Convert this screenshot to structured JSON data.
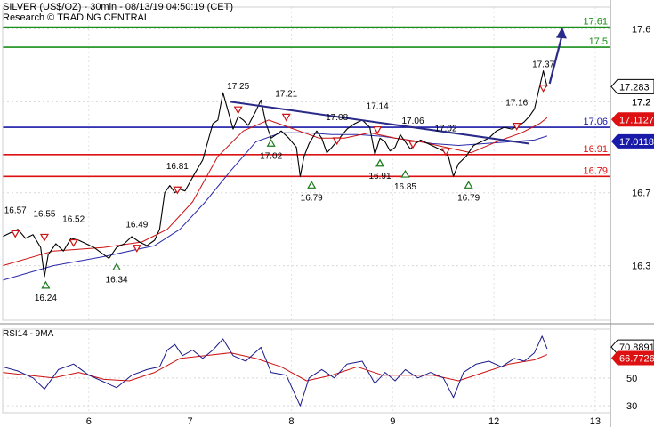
{
  "header": {
    "title": "SILVER (US$/OZ) - 30min - 08/13/19 04:50:19 (CET)",
    "subtitle": "Research © TRADING CENTRAL"
  },
  "colors": {
    "resistance": "#1a8f1a",
    "pivot": "#1a1aa8",
    "support": "#dd1111",
    "trendline": "#2a2a88",
    "arrow": "#2a2a88",
    "price": "#000000",
    "ma_fast": "#cc1111",
    "ma_slow": "#2a2aaa",
    "rsi": "#1a1a88",
    "rsi_ma": "#cc1111",
    "peak_marker": "#cc1111",
    "trough_marker": "#1a7a1a"
  },
  "chart_data": [
    {
      "type": "line",
      "name": "price-panel",
      "ylim": [
        16.0,
        17.72
      ],
      "y_ticks": [
        "17.6",
        "17.2",
        "16.7",
        "16.3"
      ],
      "x_labels": [
        "6",
        "7",
        "8",
        "9",
        "12",
        "13"
      ],
      "grid": true,
      "levels": [
        {
          "value": 17.61,
          "label": "17.61",
          "kind": "resistance"
        },
        {
          "value": 17.5,
          "label": "17.5",
          "kind": "resistance"
        },
        {
          "value": 17.06,
          "label": "17.06",
          "kind": "pivot"
        },
        {
          "value": 16.91,
          "label": "16.91",
          "kind": "support"
        },
        {
          "value": 16.79,
          "label": "16.79",
          "kind": "support"
        }
      ],
      "price_tags": [
        {
          "value": 17.283,
          "label": "17.283",
          "style": "dark"
        },
        {
          "value": 17.1127,
          "label": "17.1127",
          "style": "red"
        },
        {
          "value": 17.0118,
          "label": "17.0118",
          "style": "blue"
        }
      ],
      "partial_tick": "17.2",
      "price_points": [
        [
          0,
          16.46
        ],
        [
          0.3,
          16.48
        ],
        [
          0.6,
          16.5
        ],
        [
          0.9,
          16.45
        ],
        [
          1.2,
          16.47
        ],
        [
          1.5,
          16.4
        ],
        [
          1.65,
          16.24
        ],
        [
          1.8,
          16.36
        ],
        [
          2.1,
          16.42
        ],
        [
          2.4,
          16.38
        ],
        [
          2.7,
          16.45
        ],
        [
          3,
          16.44
        ],
        [
          3.3,
          16.42
        ],
        [
          3.6,
          16.4
        ],
        [
          3.9,
          16.37
        ],
        [
          4.2,
          16.34
        ],
        [
          4.5,
          16.4
        ],
        [
          4.8,
          16.42
        ],
        [
          5.1,
          16.46
        ],
        [
          5.4,
          16.43
        ],
        [
          5.7,
          16.41
        ],
        [
          6,
          16.44
        ],
        [
          6.2,
          16.5
        ],
        [
          6.4,
          16.7
        ],
        [
          6.6,
          16.74
        ],
        [
          6.8,
          16.7
        ],
        [
          7,
          16.72
        ],
        [
          7.2,
          16.71
        ],
        [
          7.4,
          16.76
        ],
        [
          7.6,
          16.81
        ],
        [
          7.9,
          16.88
        ],
        [
          8.1,
          16.98
        ],
        [
          8.3,
          17.08
        ],
        [
          8.5,
          17.1
        ],
        [
          8.7,
          17.25
        ],
        [
          8.9,
          17.15
        ],
        [
          9.1,
          17.05
        ],
        [
          9.3,
          17.12
        ],
        [
          9.5,
          17.1
        ],
        [
          9.7,
          17.07
        ],
        [
          10,
          17.15
        ],
        [
          10.2,
          17.21
        ],
        [
          10.4,
          17.08
        ],
        [
          10.6,
          17.0
        ],
        [
          10.8,
          17.02
        ],
        [
          11,
          17.04
        ],
        [
          11.3,
          17.0
        ],
        [
          11.6,
          16.95
        ],
        [
          11.75,
          16.79
        ],
        [
          11.9,
          16.9
        ],
        [
          12.1,
          16.97
        ],
        [
          12.4,
          17.04
        ],
        [
          12.6,
          17.0
        ],
        [
          12.8,
          16.92
        ],
        [
          13,
          16.95
        ],
        [
          13.3,
          17.0
        ],
        [
          13.6,
          17.05
        ],
        [
          13.9,
          17.08
        ],
        [
          14.2,
          17.1
        ],
        [
          14.5,
          17.06
        ],
        [
          14.7,
          16.91
        ],
        [
          14.9,
          17.0
        ],
        [
          15.1,
          16.98
        ],
        [
          15.3,
          16.93
        ],
        [
          15.5,
          16.95
        ],
        [
          15.7,
          17.02
        ],
        [
          15.9,
          16.98
        ],
        [
          16.1,
          16.94
        ],
        [
          16.3,
          16.97
        ],
        [
          16.5,
          16.99
        ],
        [
          16.8,
          16.97
        ],
        [
          17.1,
          16.95
        ],
        [
          17.4,
          16.93
        ],
        [
          17.6,
          16.9
        ],
        [
          17.8,
          16.79
        ],
        [
          18,
          16.86
        ],
        [
          18.3,
          16.9
        ],
        [
          18.6,
          16.96
        ],
        [
          18.9,
          16.98
        ],
        [
          19.2,
          17.0
        ],
        [
          19.5,
          17.04
        ],
        [
          19.8,
          17.06
        ],
        [
          20.1,
          17.05
        ],
        [
          20.4,
          17.07
        ],
        [
          20.6,
          17.09
        ],
        [
          20.8,
          17.12
        ],
        [
          21,
          17.16
        ],
        [
          21.2,
          17.28
        ],
        [
          21.35,
          17.37
        ],
        [
          21.5,
          17.283
        ]
      ],
      "ma_fast": [
        [
          0,
          16.3
        ],
        [
          2,
          16.38
        ],
        [
          4,
          16.4
        ],
        [
          5.5,
          16.43
        ],
        [
          6.5,
          16.5
        ],
        [
          7.5,
          16.65
        ],
        [
          8.5,
          16.9
        ],
        [
          9.5,
          17.04
        ],
        [
          10.5,
          17.1
        ],
        [
          11.5,
          17.05
        ],
        [
          12.5,
          17.0
        ],
        [
          13.5,
          17.0
        ],
        [
          14.5,
          17.03
        ],
        [
          15.5,
          17.0
        ],
        [
          16.5,
          16.98
        ],
        [
          17.5,
          16.95
        ],
        [
          18.5,
          16.92
        ],
        [
          19.5,
          16.98
        ],
        [
          20.5,
          17.03
        ],
        [
          21.2,
          17.08
        ],
        [
          21.5,
          17.1127
        ]
      ],
      "ma_slow": [
        [
          0,
          16.22
        ],
        [
          2,
          16.3
        ],
        [
          4,
          16.35
        ],
        [
          6,
          16.41
        ],
        [
          7,
          16.5
        ],
        [
          8,
          16.65
        ],
        [
          9,
          16.82
        ],
        [
          10,
          16.98
        ],
        [
          11,
          17.03
        ],
        [
          12,
          17.03
        ],
        [
          13,
          17.02
        ],
        [
          14,
          17.02
        ],
        [
          15,
          17.01
        ],
        [
          16,
          16.99
        ],
        [
          17,
          16.97
        ],
        [
          18,
          16.96
        ],
        [
          19,
          16.97
        ],
        [
          20,
          16.98
        ],
        [
          21,
          16.99
        ],
        [
          21.5,
          17.0118
        ]
      ],
      "trendline": [
        [
          9.0,
          17.2
        ],
        [
          20.8,
          16.97
        ]
      ],
      "forecast_arrow": [
        [
          21.6,
          17.3
        ],
        [
          22.1,
          17.61
        ]
      ],
      "peaks": [
        {
          "x": 0.5,
          "value": 16.57,
          "label": "16.57"
        },
        {
          "x": 1.65,
          "value": 16.55,
          "label": "16.55"
        },
        {
          "x": 2.8,
          "value": 16.52,
          "label": "16.52"
        },
        {
          "x": 5.3,
          "value": 16.49,
          "label": "16.49"
        },
        {
          "x": 6.9,
          "value": 16.81,
          "label": "16.81"
        },
        {
          "x": 9.3,
          "value": 17.25,
          "label": "17.25"
        },
        {
          "x": 11.2,
          "value": 17.21,
          "label": "17.21"
        },
        {
          "x": 13.2,
          "value": 17.08,
          "label": "17.08"
        },
        {
          "x": 14.8,
          "value": 17.14,
          "label": "17.14"
        },
        {
          "x": 16.2,
          "value": 17.06,
          "label": "17.06"
        },
        {
          "x": 17.5,
          "value": 17.02,
          "label": "17.02"
        },
        {
          "x": 20.3,
          "value": 17.16,
          "label": "17.16"
        },
        {
          "x": 21.35,
          "value": 17.37,
          "label": "17.37"
        }
      ],
      "troughs": [
        {
          "x": 1.7,
          "value": 16.24,
          "label": "16.24"
        },
        {
          "x": 4.5,
          "value": 16.34,
          "label": "16.34"
        },
        {
          "x": 10.6,
          "value": 17.02,
          "label": "17.02"
        },
        {
          "x": 12.2,
          "value": 16.79,
          "label": "16.79"
        },
        {
          "x": 14.9,
          "value": 16.91,
          "label": "16.91"
        },
        {
          "x": 15.9,
          "value": 16.85,
          "label": "16.85"
        },
        {
          "x": 18.4,
          "value": 16.79,
          "label": "16.79"
        }
      ]
    },
    {
      "type": "line",
      "name": "rsi-panel",
      "title": "RSI14 - 9MA",
      "ylim": [
        25,
        85
      ],
      "y_ticks": [
        "70",
        "50",
        "30"
      ],
      "value_tags": [
        {
          "value": 70.8891,
          "label": "70.8891",
          "style": "dark"
        },
        {
          "value": 66.7726,
          "label": "66.7726",
          "style": "red"
        }
      ],
      "rsi": [
        [
          0,
          58
        ],
        [
          0.6,
          55
        ],
        [
          1.2,
          50
        ],
        [
          1.65,
          42
        ],
        [
          2.2,
          56
        ],
        [
          2.8,
          60
        ],
        [
          3.4,
          52
        ],
        [
          3.9,
          48
        ],
        [
          4.5,
          43
        ],
        [
          5.1,
          52
        ],
        [
          5.7,
          56
        ],
        [
          6.2,
          58
        ],
        [
          6.5,
          70
        ],
        [
          6.8,
          74
        ],
        [
          7.1,
          66
        ],
        [
          7.5,
          70
        ],
        [
          7.9,
          64
        ],
        [
          8.3,
          70
        ],
        [
          8.7,
          78
        ],
        [
          9.1,
          66
        ],
        [
          9.6,
          62
        ],
        [
          10.2,
          72
        ],
        [
          10.6,
          54
        ],
        [
          11.2,
          52
        ],
        [
          11.75,
          30
        ],
        [
          12.1,
          50
        ],
        [
          12.6,
          56
        ],
        [
          13.1,
          50
        ],
        [
          13.6,
          60
        ],
        [
          14.2,
          62
        ],
        [
          14.7,
          46
        ],
        [
          15.1,
          54
        ],
        [
          15.5,
          48
        ],
        [
          15.9,
          56
        ],
        [
          16.4,
          50
        ],
        [
          16.9,
          54
        ],
        [
          17.4,
          50
        ],
        [
          17.8,
          36
        ],
        [
          18.2,
          54
        ],
        [
          18.7,
          60
        ],
        [
          19.2,
          62
        ],
        [
          19.7,
          58
        ],
        [
          20.2,
          64
        ],
        [
          20.6,
          62
        ],
        [
          21,
          68
        ],
        [
          21.3,
          80
        ],
        [
          21.5,
          70.89
        ]
      ],
      "rsi_ma": [
        [
          0,
          54
        ],
        [
          1,
          52
        ],
        [
          2,
          50
        ],
        [
          3,
          54
        ],
        [
          4,
          49
        ],
        [
          5,
          48
        ],
        [
          6,
          54
        ],
        [
          7,
          64
        ],
        [
          8,
          66
        ],
        [
          9,
          68
        ],
        [
          10,
          64
        ],
        [
          11,
          58
        ],
        [
          12,
          48
        ],
        [
          13,
          52
        ],
        [
          14,
          58
        ],
        [
          15,
          52
        ],
        [
          16,
          52
        ],
        [
          17,
          52
        ],
        [
          18,
          48
        ],
        [
          19,
          54
        ],
        [
          20,
          60
        ],
        [
          21,
          63
        ],
        [
          21.5,
          66.77
        ]
      ]
    }
  ]
}
